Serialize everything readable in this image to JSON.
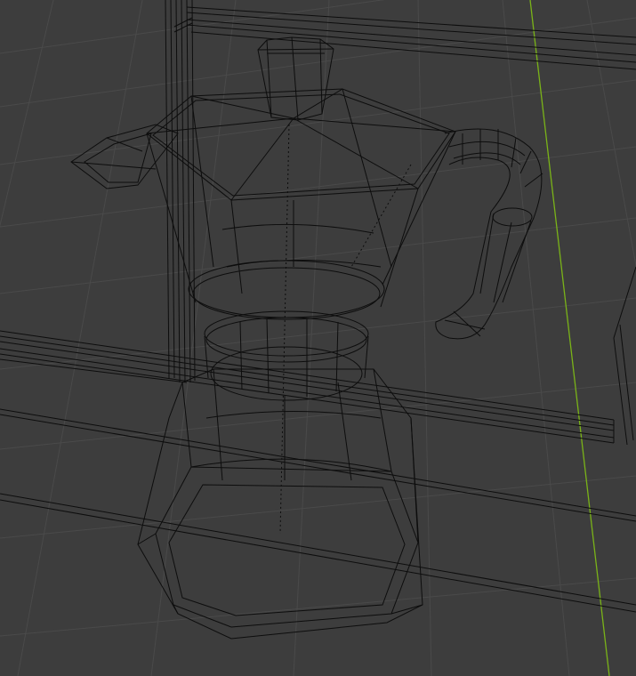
{
  "viewport": {
    "view": "3d-viewport",
    "shading": "wireframe",
    "background_color": "#3d3d3d",
    "grid_color": "#4a4a4a",
    "wire_color": "#0d0d0d",
    "y_axis_color": "#7ab318",
    "objects": [
      "moka-pot",
      "table-surface",
      "counter-block"
    ]
  }
}
